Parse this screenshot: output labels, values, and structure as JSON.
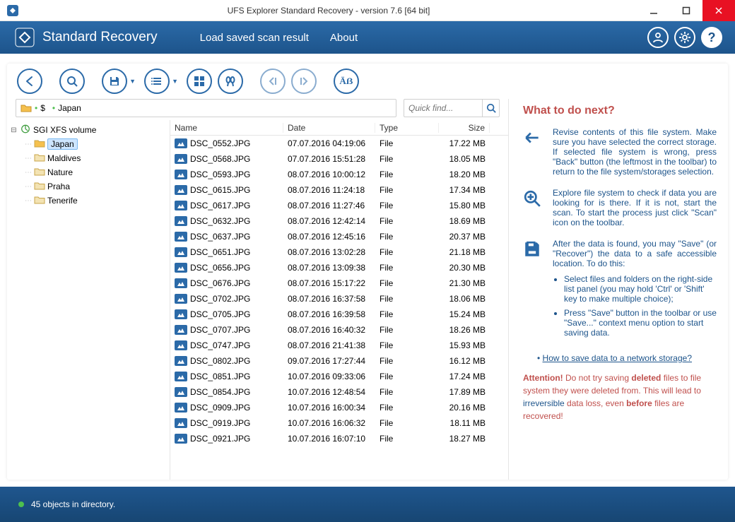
{
  "window": {
    "title": "UFS Explorer Standard Recovery - version 7.6 [64 bit]"
  },
  "header": {
    "product": "Standard Recovery",
    "menu": {
      "load_scan": "Load saved scan result",
      "about": "About"
    }
  },
  "breadcrumb": {
    "root": "$",
    "current": "Japan"
  },
  "search": {
    "placeholder": "Quick find..."
  },
  "tree": {
    "volume": "SGI XFS volume",
    "folders": [
      "Japan",
      "Maldives",
      "Nature",
      "Praha",
      "Tenerife"
    ],
    "selected": "Japan"
  },
  "columns": {
    "name": "Name",
    "date": "Date",
    "type": "Type",
    "size": "Size"
  },
  "files": [
    {
      "name": "DSC_0552.JPG",
      "date": "07.07.2016 04:19:06",
      "type": "File",
      "size": "17.22 MB"
    },
    {
      "name": "DSC_0568.JPG",
      "date": "07.07.2016 15:51:28",
      "type": "File",
      "size": "18.05 MB"
    },
    {
      "name": "DSC_0593.JPG",
      "date": "08.07.2016 10:00:12",
      "type": "File",
      "size": "18.20 MB"
    },
    {
      "name": "DSC_0615.JPG",
      "date": "08.07.2016 11:24:18",
      "type": "File",
      "size": "17.34 MB"
    },
    {
      "name": "DSC_0617.JPG",
      "date": "08.07.2016 11:27:46",
      "type": "File",
      "size": "15.80 MB"
    },
    {
      "name": "DSC_0632.JPG",
      "date": "08.07.2016 12:42:14",
      "type": "File",
      "size": "18.69 MB"
    },
    {
      "name": "DSC_0637.JPG",
      "date": "08.07.2016 12:45:16",
      "type": "File",
      "size": "20.37 MB"
    },
    {
      "name": "DSC_0651.JPG",
      "date": "08.07.2016 13:02:28",
      "type": "File",
      "size": "21.18 MB"
    },
    {
      "name": "DSC_0656.JPG",
      "date": "08.07.2016 13:09:38",
      "type": "File",
      "size": "20.30 MB"
    },
    {
      "name": "DSC_0676.JPG",
      "date": "08.07.2016 15:17:22",
      "type": "File",
      "size": "21.30 MB"
    },
    {
      "name": "DSC_0702.JPG",
      "date": "08.07.2016 16:37:58",
      "type": "File",
      "size": "18.06 MB"
    },
    {
      "name": "DSC_0705.JPG",
      "date": "08.07.2016 16:39:58",
      "type": "File",
      "size": "15.24 MB"
    },
    {
      "name": "DSC_0707.JPG",
      "date": "08.07.2016 16:40:32",
      "type": "File",
      "size": "18.26 MB"
    },
    {
      "name": "DSC_0747.JPG",
      "date": "08.07.2016 21:41:38",
      "type": "File",
      "size": "15.93 MB"
    },
    {
      "name": "DSC_0802.JPG",
      "date": "09.07.2016 17:27:44",
      "type": "File",
      "size": "16.12 MB"
    },
    {
      "name": "DSC_0851.JPG",
      "date": "10.07.2016 09:33:06",
      "type": "File",
      "size": "17.24 MB"
    },
    {
      "name": "DSC_0854.JPG",
      "date": "10.07.2016 12:48:54",
      "type": "File",
      "size": "17.89 MB"
    },
    {
      "name": "DSC_0909.JPG",
      "date": "10.07.2016 16:00:34",
      "type": "File",
      "size": "20.16 MB"
    },
    {
      "name": "DSC_0919.JPG",
      "date": "10.07.2016 16:06:32",
      "type": "File",
      "size": "18.11 MB"
    },
    {
      "name": "DSC_0921.JPG",
      "date": "10.07.2016 16:07:10",
      "type": "File",
      "size": "18.27 MB"
    }
  ],
  "help": {
    "title": "What to do next?",
    "p1": "Revise contents of this file system. Make sure you have selected the correct storage. If selected file system is wrong, press \"Back\" button (the leftmost in the toolbar) to return to the file system/storages selection.",
    "p2": "Explore file system to check if data you are looking for is there. If it is not, start the scan. To start the process just click \"Scan\" icon on the toolbar.",
    "p3": "After the data is found, you may \"Save\" (or \"Recover\") the data to a safe accessible location. To do this:",
    "li1": "Select files and folders on the right-side list panel (you may hold 'Ctrl' or 'Shift' key to make multiple choice);",
    "li2": "Press \"Save\" button in the toolbar or use \"Save...\" context menu option to start saving data.",
    "link": "How to save data to a network storage?",
    "attention_label": "Attention!",
    "attention_1": " Do not try saving ",
    "attention_deleted": "deleted",
    "attention_2": " files to file system they were deleted from. This will lead to ",
    "attention_irr": "irreversible",
    "attention_3": " data loss, even ",
    "attention_before": "before",
    "attention_4": " files are recovered!"
  },
  "status": {
    "text": "45 objects in directory."
  }
}
